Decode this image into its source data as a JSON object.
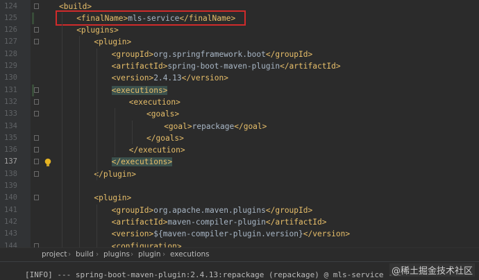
{
  "editor": {
    "lines": [
      {
        "num": "124",
        "parts": [
          {
            "t": "<build>",
            "c": "tag"
          }
        ]
      },
      {
        "num": "125",
        "parts": [
          {
            "t": "<finalName>",
            "c": "tag"
          },
          {
            "t": "mls-service",
            "c": "text"
          },
          {
            "t": "</finalName>",
            "c": "tag"
          }
        ]
      },
      {
        "num": "126",
        "parts": [
          {
            "t": "<plugins>",
            "c": "tag"
          }
        ]
      },
      {
        "num": "127",
        "parts": [
          {
            "t": "<plugin>",
            "c": "tag"
          }
        ]
      },
      {
        "num": "128",
        "parts": [
          {
            "t": "<groupId>",
            "c": "tag"
          },
          {
            "t": "org.springframework.boot",
            "c": "text"
          },
          {
            "t": "</groupId>",
            "c": "tag"
          }
        ]
      },
      {
        "num": "129",
        "parts": [
          {
            "t": "<artifactId>",
            "c": "tag"
          },
          {
            "t": "spring-boot-maven-plugin",
            "c": "text"
          },
          {
            "t": "</artifactId>",
            "c": "tag"
          }
        ]
      },
      {
        "num": "130",
        "parts": [
          {
            "t": "<version>",
            "c": "tag"
          },
          {
            "t": "2.4.13",
            "c": "text"
          },
          {
            "t": "</version>",
            "c": "tag"
          }
        ]
      },
      {
        "num": "131",
        "parts": [
          {
            "t": "<executions>",
            "c": "tag hl-tag"
          }
        ]
      },
      {
        "num": "132",
        "parts": [
          {
            "t": "<execution>",
            "c": "tag"
          }
        ]
      },
      {
        "num": "133",
        "parts": [
          {
            "t": "<goals>",
            "c": "tag"
          }
        ]
      },
      {
        "num": "134",
        "parts": [
          {
            "t": "<goal>",
            "c": "tag"
          },
          {
            "t": "repackage",
            "c": "text"
          },
          {
            "t": "</goal>",
            "c": "tag"
          }
        ]
      },
      {
        "num": "135",
        "parts": [
          {
            "t": "</goals>",
            "c": "tag"
          }
        ]
      },
      {
        "num": "136",
        "parts": [
          {
            "t": "</execution>",
            "c": "tag"
          }
        ]
      },
      {
        "num": "137",
        "parts": [
          {
            "t": "</executions>",
            "c": "tag hl-tag"
          }
        ]
      },
      {
        "num": "138",
        "parts": [
          {
            "t": "</plugin>",
            "c": "tag"
          }
        ]
      },
      {
        "num": "139",
        "parts": []
      },
      {
        "num": "140",
        "parts": [
          {
            "t": "<plugin>",
            "c": "tag"
          }
        ]
      },
      {
        "num": "141",
        "parts": [
          {
            "t": "<groupId>",
            "c": "tag"
          },
          {
            "t": "org.apache.maven.plugins",
            "c": "text"
          },
          {
            "t": "</groupId>",
            "c": "tag"
          }
        ]
      },
      {
        "num": "142",
        "parts": [
          {
            "t": "<artifactId>",
            "c": "tag"
          },
          {
            "t": "maven-compiler-plugin",
            "c": "text"
          },
          {
            "t": "</artifactId>",
            "c": "tag"
          }
        ]
      },
      {
        "num": "143",
        "parts": [
          {
            "t": "<version>",
            "c": "tag"
          },
          {
            "t": "${maven-compiler-plugin.version}",
            "c": "text"
          },
          {
            "t": "</version>",
            "c": "tag"
          }
        ]
      },
      {
        "num": "144",
        "parts": [
          {
            "t": "<configuration>",
            "c": "tag"
          }
        ]
      }
    ]
  },
  "breadcrumb": [
    "project",
    "build",
    "plugins",
    "plugin",
    "executions"
  ],
  "console": {
    "text": "[INFO] --- spring-boot-maven-plugin:2.4.13:repackage (repackage) @ mls-service ---"
  },
  "watermark": "@稀土掘金技术社区",
  "colors": {
    "tag": "#e8bf6a",
    "text": "#a9b7c6",
    "highlight_box": "#d12b2b"
  }
}
